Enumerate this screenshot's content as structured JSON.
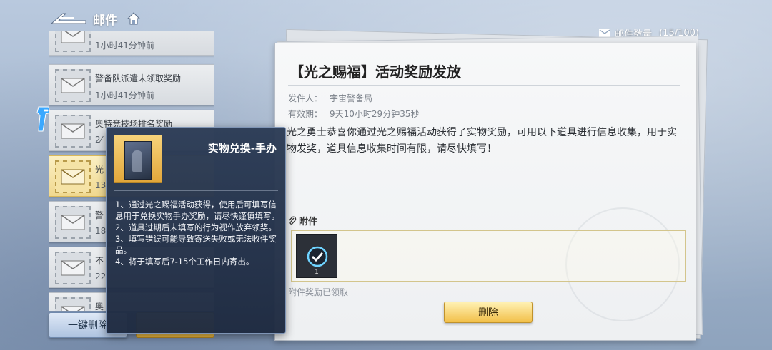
{
  "header": {
    "title": "邮件"
  },
  "mail_count": {
    "label": "邮件数量",
    "value": "(15/100)"
  },
  "mail_list": [
    {
      "title": "",
      "time": "1小时41分钟前"
    },
    {
      "title": "警备队派遣未领取奖励",
      "time": "1小时41分钟前"
    },
    {
      "title": "奥特竞技场排名奖励",
      "time": "2⁄"
    },
    {
      "title": "光",
      "time": "13"
    },
    {
      "title": "警",
      "time": "18"
    },
    {
      "title": "不",
      "time": "22"
    },
    {
      "title": "奥",
      "time": ""
    }
  ],
  "buttons": {
    "one_click_delete": "一键删除",
    "delete": "删除"
  },
  "mail": {
    "title": "【光之赐福】活动奖励发放",
    "sender_label": "发件人：",
    "sender": "宇宙警备局",
    "validity_label": "有效期：",
    "validity": "9天10小时29分钟35秒",
    "body": "光之勇士恭喜你通过光之赐福活动获得了实物奖励，可用以下道具进行信息收集，用于实物发奖，道具信息收集时间有限，请尽快填写！",
    "attachment_label": "附件",
    "attachment_qty": "1",
    "attachment_status": "附件奖励已领取"
  },
  "tooltip": {
    "title": "实物兑换-手办",
    "lines": [
      "1、通过光之赐福活动获得，使用后可填写信息用于兑换实物手办奖励，请尽快谨慎填写。",
      "2、道具过期后未填写的行为视作放弃领奖。",
      "3、填写错误可能导致寄送失败或无法收件奖品。",
      "4、将于填写后7-15个工作日内寄出。"
    ]
  },
  "colors": {
    "accent_gold": "#f2c04a",
    "panel_dark": "#2c3c56",
    "selected_mail": "#f0d88f"
  }
}
